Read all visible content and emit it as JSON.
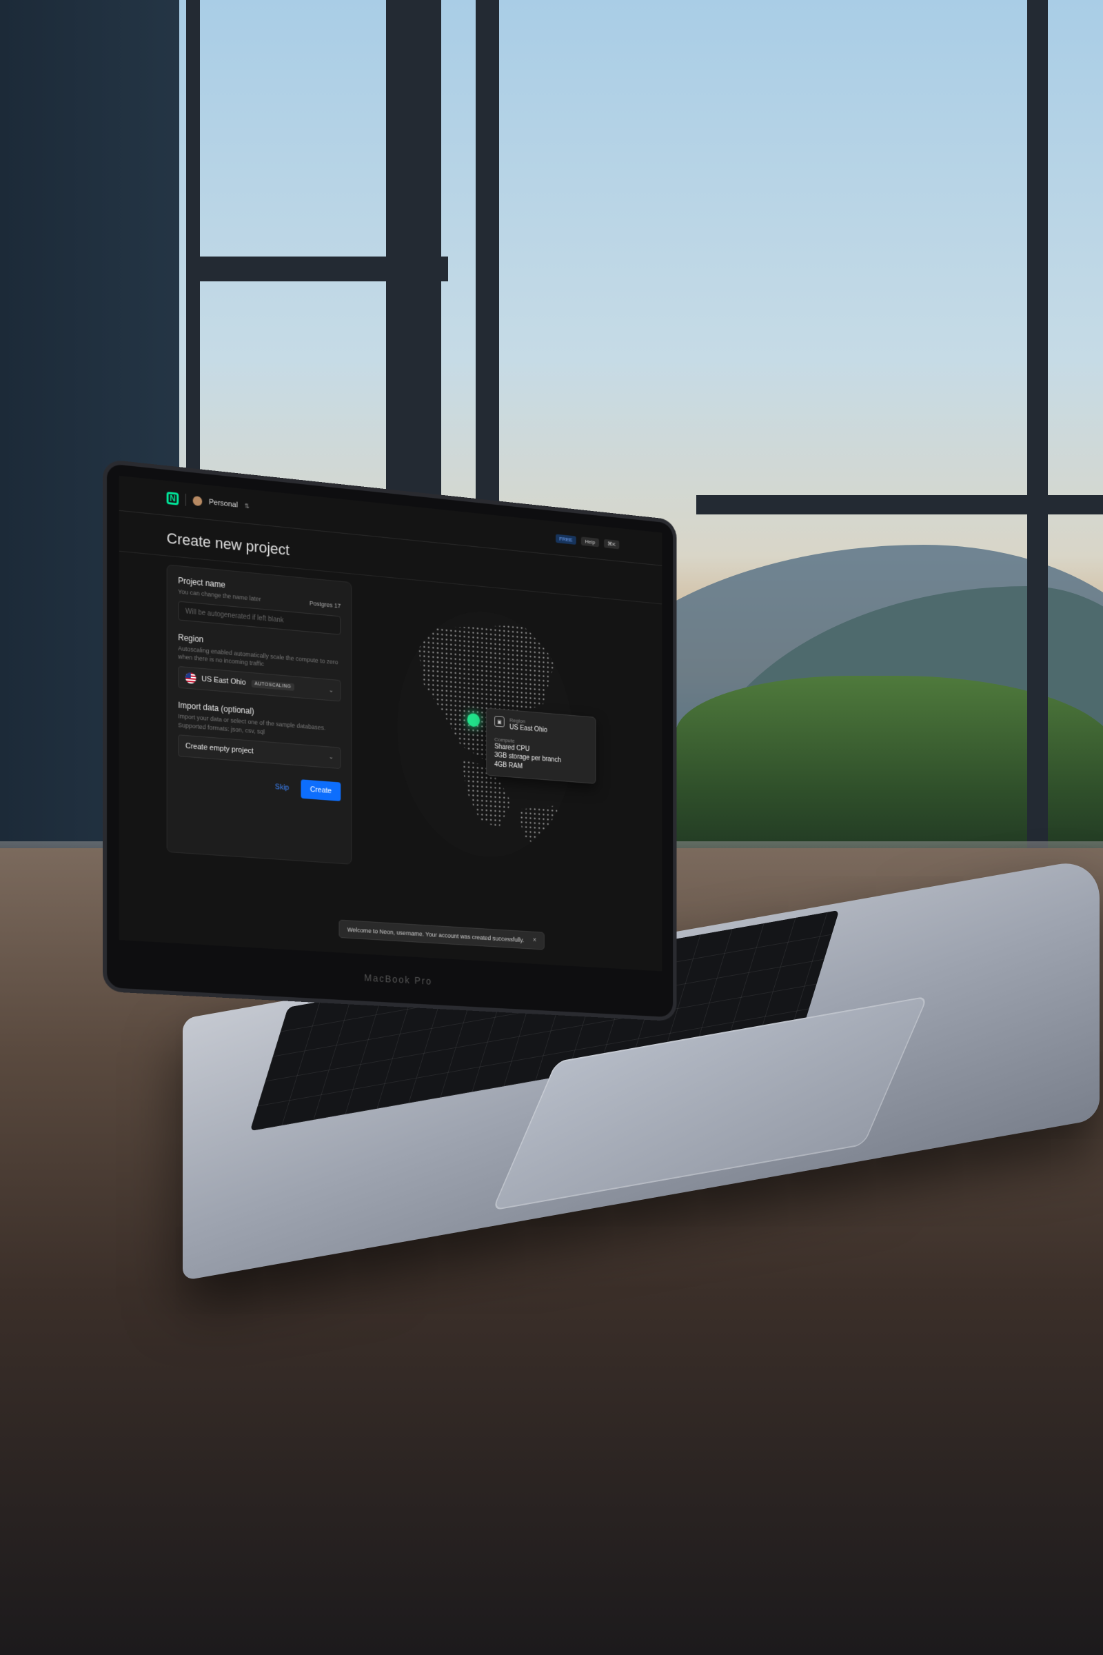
{
  "topbar": {
    "workspace": "Personal",
    "pill_blue": "FREE",
    "pill_help": "Help",
    "pill_kbd": "⌘K"
  },
  "page": {
    "title": "Create new project"
  },
  "form": {
    "project_name": {
      "label": "Project name",
      "hint": "You can change the name later",
      "placeholder": "Will be autogenerated if left blank",
      "postgres_version": "Postgres 17"
    },
    "region": {
      "label": "Region",
      "hint": "Autoscaling enabled automatically scale the compute to zero when there is no incoming traffic",
      "value": "US East Ohio",
      "badge": "AUTOSCALING"
    },
    "import": {
      "label": "Import data (optional)",
      "hint": "Import your data or select one of the sample databases. Supported formats: json, csv, sql",
      "value": "Create empty project"
    },
    "skip_label": "Skip",
    "create_label": "Create"
  },
  "map_popover": {
    "region_label": "Region",
    "region_value": "US East Ohio",
    "compute_label": "Compute",
    "compute_line1": "Shared CPU",
    "compute_line2": "3GB storage per branch",
    "compute_line3": "4GB RAM"
  },
  "toast": {
    "message": "Welcome to Neon, username. Your account was created successfully.",
    "close": "×"
  },
  "bezel_label": "MacBook Pro",
  "colors": {
    "accent": "#00e599",
    "primary_button": "#0d6efd",
    "marker": "#22e28a"
  }
}
